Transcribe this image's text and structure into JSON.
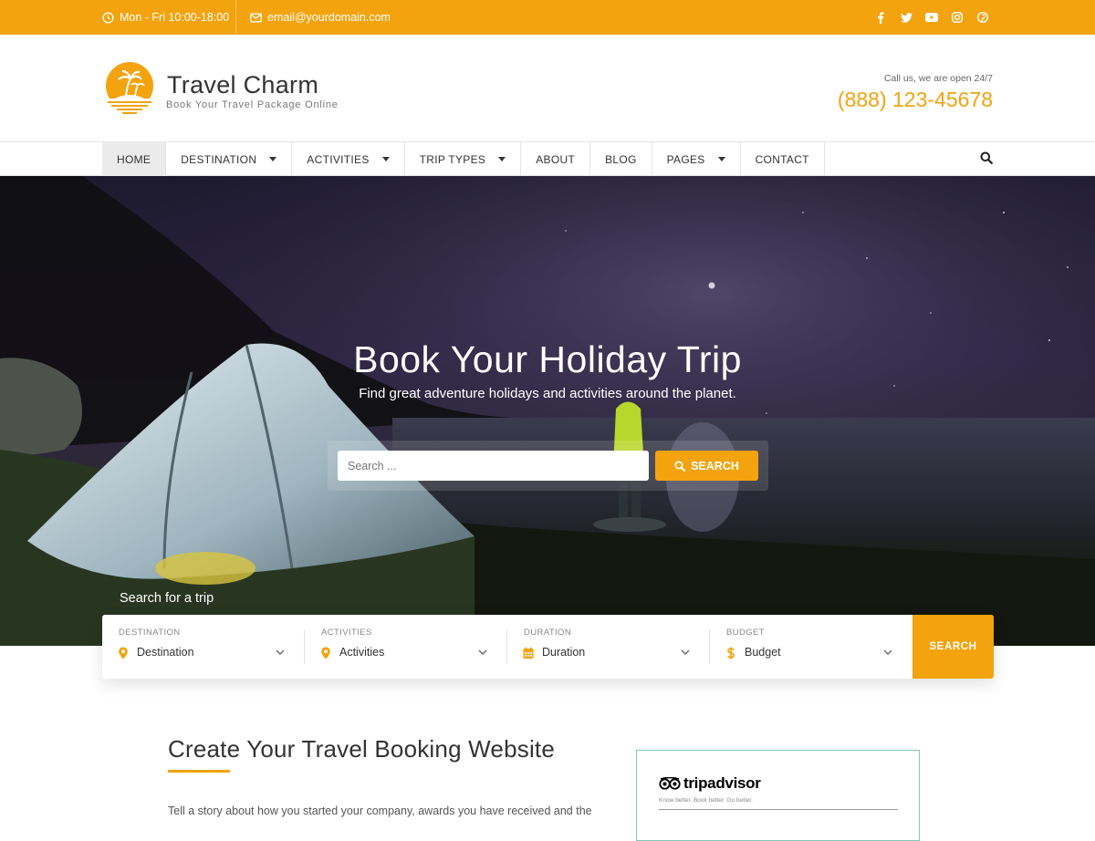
{
  "topbar": {
    "hours": "Mon - Fri 10:00-18:00",
    "email": "email@yourdomain.com",
    "socials": [
      "facebook-icon",
      "twitter-icon",
      "youtube-icon",
      "instagram-icon",
      "pinterest-icon"
    ]
  },
  "header": {
    "site_title": "Travel Charm",
    "tagline": "Book Your Travel Package Online",
    "call_label": "Call us, we are open 24/7",
    "phone": "(888) 123-45678"
  },
  "nav": {
    "items": [
      {
        "label": "HOME",
        "active": true,
        "dropdown": false
      },
      {
        "label": "DESTINATION",
        "active": false,
        "dropdown": true
      },
      {
        "label": "ACTIVITIES",
        "active": false,
        "dropdown": true
      },
      {
        "label": "TRIP TYPES",
        "active": false,
        "dropdown": true
      },
      {
        "label": "ABOUT",
        "active": false,
        "dropdown": false
      },
      {
        "label": "BLOG",
        "active": false,
        "dropdown": false
      },
      {
        "label": "PAGES",
        "active": false,
        "dropdown": true
      },
      {
        "label": "CONTACT",
        "active": false,
        "dropdown": false
      }
    ]
  },
  "hero": {
    "title": "Book Your Holiday Trip",
    "subtitle": "Find great adventure holidays and activities around the planet.",
    "search_placeholder": "Search ...",
    "search_button": "SEARCH",
    "trip_label": "Search for a trip"
  },
  "trip_search": {
    "fields": [
      {
        "label": "DESTINATION",
        "value": "Destination",
        "icon": "map-pin-icon"
      },
      {
        "label": "ACTIVITIES",
        "value": "Activities",
        "icon": "map-pin-icon"
      },
      {
        "label": "DURATION",
        "value": "Duration",
        "icon": "calendar-icon"
      },
      {
        "label": "BUDGET",
        "value": "Budget",
        "icon": "dollar-icon"
      }
    ],
    "button": "SEARCH"
  },
  "content": {
    "title": "Create Your Travel Booking Website",
    "paragraph": "Tell a story about how you started your company, awards you have received and the"
  },
  "tripadvisor": {
    "name": "tripadvisor",
    "tagline": "Know better. Book better. Go better."
  },
  "colors": {
    "accent": "#f2a30e",
    "tripadvisor_border": "#7ec8b8"
  }
}
